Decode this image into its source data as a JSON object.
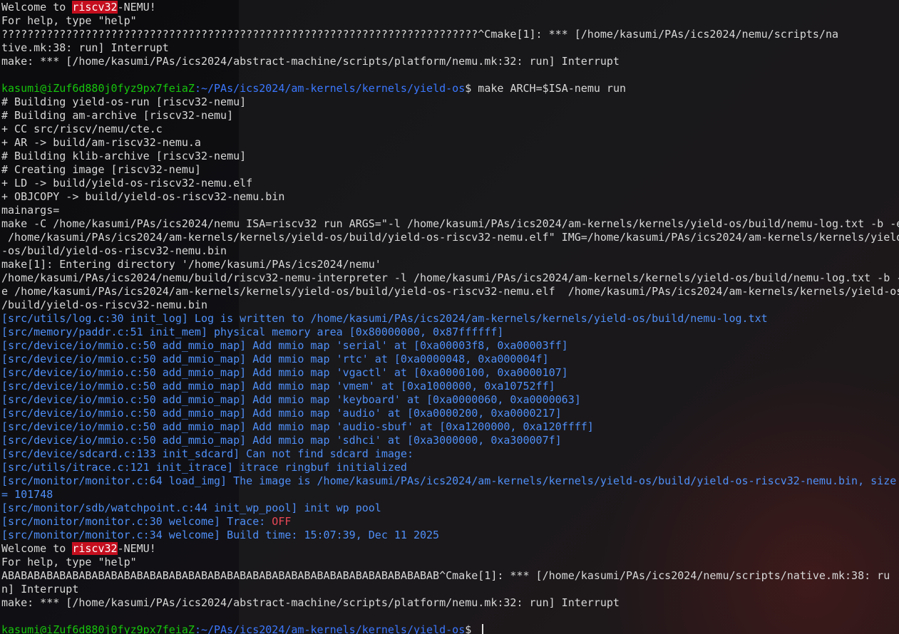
{
  "terminal": {
    "lines": [
      {
        "type": "welcome",
        "pre": "Welcome to ",
        "hl": "riscv32",
        "post": "-NEMU!"
      },
      {
        "type": "text",
        "text": "For help, type \"help\""
      },
      {
        "type": "text",
        "text": "??????????????????????????????????????????????????????????????????????????^Cmake[1]: *** [/home/kasumi/PAs/ics2024/nemu/scripts/na"
      },
      {
        "type": "text",
        "text": "tive.mk:38: run] Interrupt"
      },
      {
        "type": "text",
        "text": "make: *** [/home/kasumi/PAs/ics2024/abstract-machine/scripts/platform/nemu.mk:32: run] Interrupt"
      },
      {
        "type": "text",
        "text": ""
      },
      {
        "type": "prompt",
        "user": "kasumi@iZuf6d880j0fyz9px7feiaZ",
        "path": ":~/PAs/ics2024/am-kernels/kernels/yield-os",
        "cmd": "$ make ARCH=$ISA-nemu run"
      },
      {
        "type": "text",
        "text": "# Building yield-os-run [riscv32-nemu]"
      },
      {
        "type": "text",
        "text": "# Building am-archive [riscv32-nemu]"
      },
      {
        "type": "text",
        "text": "+ CC src/riscv/nemu/cte.c"
      },
      {
        "type": "text",
        "text": "+ AR -> build/am-riscv32-nemu.a"
      },
      {
        "type": "text",
        "text": "# Building klib-archive [riscv32-nemu]"
      },
      {
        "type": "text",
        "text": "# Creating image [riscv32-nemu]"
      },
      {
        "type": "text",
        "text": "+ LD -> build/yield-os-riscv32-nemu.elf"
      },
      {
        "type": "text",
        "text": "+ OBJCOPY -> build/yield-os-riscv32-nemu.bin"
      },
      {
        "type": "text",
        "text": "mainargs="
      },
      {
        "type": "text",
        "text": "make -C /home/kasumi/PAs/ics2024/nemu ISA=riscv32 run ARGS=\"-l /home/kasumi/PAs/ics2024/am-kernels/kernels/yield-os/build/nemu-log.txt -b -e"
      },
      {
        "type": "text",
        "text": " /home/kasumi/PAs/ics2024/am-kernels/kernels/yield-os/build/yield-os-riscv32-nemu.elf\" IMG=/home/kasumi/PAs/ics2024/am-kernels/kernels/yield"
      },
      {
        "type": "text",
        "text": "-os/build/yield-os-riscv32-nemu.bin"
      },
      {
        "type": "text",
        "text": "make[1]: Entering directory '/home/kasumi/PAs/ics2024/nemu'"
      },
      {
        "type": "text",
        "text": "/home/kasumi/PAs/ics2024/nemu/build/riscv32-nemu-interpreter -l /home/kasumi/PAs/ics2024/am-kernels/kernels/yield-os/build/nemu-log.txt -b -"
      },
      {
        "type": "text",
        "text": "e /home/kasumi/PAs/ics2024/am-kernels/kernels/yield-os/build/yield-os-riscv32-nemu.elf  /home/kasumi/PAs/ics2024/am-kernels/kernels/yield-os"
      },
      {
        "type": "text",
        "text": "/build/yield-os-riscv32-nemu.bin"
      },
      {
        "type": "log",
        "text": "[src/utils/log.c:30 init_log] Log is written to /home/kasumi/PAs/ics2024/am-kernels/kernels/yield-os/build/nemu-log.txt"
      },
      {
        "type": "log",
        "text": "[src/memory/paddr.c:51 init_mem] physical memory area [0x80000000, 0x87ffffff]"
      },
      {
        "type": "log",
        "text": "[src/device/io/mmio.c:50 add_mmio_map] Add mmio map 'serial' at [0xa00003f8, 0xa00003ff]"
      },
      {
        "type": "log",
        "text": "[src/device/io/mmio.c:50 add_mmio_map] Add mmio map 'rtc' at [0xa0000048, 0xa000004f]"
      },
      {
        "type": "log",
        "text": "[src/device/io/mmio.c:50 add_mmio_map] Add mmio map 'vgactl' at [0xa0000100, 0xa0000107]"
      },
      {
        "type": "log",
        "text": "[src/device/io/mmio.c:50 add_mmio_map] Add mmio map 'vmem' at [0xa1000000, 0xa10752ff]"
      },
      {
        "type": "log",
        "text": "[src/device/io/mmio.c:50 add_mmio_map] Add mmio map 'keyboard' at [0xa0000060, 0xa0000063]"
      },
      {
        "type": "log",
        "text": "[src/device/io/mmio.c:50 add_mmio_map] Add mmio map 'audio' at [0xa0000200, 0xa0000217]"
      },
      {
        "type": "log",
        "text": "[src/device/io/mmio.c:50 add_mmio_map] Add mmio map 'audio-sbuf' at [0xa1200000, 0xa120ffff]"
      },
      {
        "type": "log",
        "text": "[src/device/io/mmio.c:50 add_mmio_map] Add mmio map 'sdhci' at [0xa3000000, 0xa300007f]"
      },
      {
        "type": "log",
        "text": "[src/device/sdcard.c:133 init_sdcard] Can not find sdcard image:"
      },
      {
        "type": "log",
        "text": "[src/utils/itrace.c:121 init_itrace] itrace ringbuf initialized"
      },
      {
        "type": "log",
        "text": "[src/monitor/monitor.c:64 load_img] The image is /home/kasumi/PAs/ics2024/am-kernels/kernels/yield-os/build/yield-os-riscv32-nemu.bin, size"
      },
      {
        "type": "log",
        "text": "= 101748"
      },
      {
        "type": "log",
        "text": "[src/monitor/sdb/watchpoint.c:44 init_wp_pool] init wp pool"
      },
      {
        "type": "trace",
        "text": "[src/monitor/monitor.c:30 welcome] Trace: ",
        "value": "OFF"
      },
      {
        "type": "log",
        "text": "[src/monitor/monitor.c:34 welcome] Build time: 15:07:39, Dec 11 2025"
      },
      {
        "type": "welcome",
        "pre": "Welcome to ",
        "hl": "riscv32",
        "post": "-NEMU!"
      },
      {
        "type": "text",
        "text": "For help, type \"help\""
      },
      {
        "type": "text",
        "text": "ABABABABABABABABABABABABABABABABABABABABABABABABABABABABABABABABABAB^Cmake[1]: *** [/home/kasumi/PAs/ics2024/nemu/scripts/native.mk:38: ru"
      },
      {
        "type": "text",
        "text": "n] Interrupt"
      },
      {
        "type": "text",
        "text": "make: *** [/home/kasumi/PAs/ics2024/abstract-machine/scripts/platform/nemu.mk:32: run] Interrupt"
      },
      {
        "type": "text",
        "text": ""
      },
      {
        "type": "prompt",
        "user": "kasumi@iZuf6d880j0fyz9px7feiaZ",
        "path": ":~/PAs/ics2024/am-kernels/kernels/yield-os",
        "cmd": "$ ",
        "cursor": true
      }
    ]
  },
  "colors": {
    "foreground": "#d8d8d8",
    "log_blue": "#4f8ff7",
    "prompt_user_green": "#16c60c",
    "prompt_path_blue": "#3b78ff",
    "highlight_red_bg": "#c50f1f",
    "off_red": "#e74856"
  }
}
